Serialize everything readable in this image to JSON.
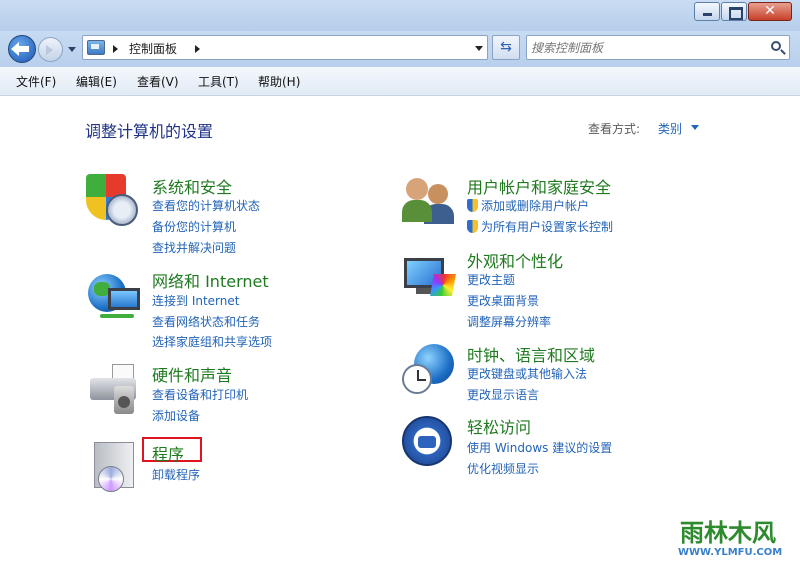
{
  "navbar": {
    "address_path": "控制面板",
    "search_placeholder": "搜索控制面板"
  },
  "menu": [
    "文件(F)",
    "编辑(E)",
    "查看(V)",
    "工具(T)",
    "帮助(H)"
  ],
  "content": {
    "title": "调整计算机的设置",
    "view_label": "查看方式:",
    "view_value": "类别"
  },
  "categories": [
    {
      "title": "系统和安全",
      "links": [
        "查看您的计算机状态",
        "备份您的计算机",
        "查找并解决问题"
      ],
      "icon": "shield-icon"
    },
    {
      "title": "网络和 Internet",
      "links": [
        "连接到 Internet",
        "查看网络状态和任务",
        "选择家庭组和共享选项"
      ],
      "icon": "network-globe-icon"
    },
    {
      "title": "硬件和声音",
      "links": [
        "查看设备和打印机",
        "添加设备"
      ],
      "icon": "printer-speaker-icon"
    },
    {
      "title": "程序",
      "links": [
        "卸载程序"
      ],
      "icon": "programs-disc-icon"
    },
    {
      "title": "用户帐户和家庭安全",
      "links": [
        "添加或删除用户帐户",
        "为所有用户设置家长控制"
      ],
      "icon": "users-icon"
    },
    {
      "title": "外观和个性化",
      "links": [
        "更改主题",
        "更改桌面背景",
        "调整屏幕分辨率"
      ],
      "icon": "monitor-palette-icon"
    },
    {
      "title": "时钟、语言和区域",
      "links": [
        "更改键盘或其他输入法",
        "更改显示语言"
      ],
      "icon": "clock-globe-icon"
    },
    {
      "title": "轻松访问",
      "links": [
        "使用 Windows 建议的设置",
        "优化视频显示"
      ],
      "icon": "ease-of-access-icon"
    }
  ],
  "watermark": {
    "text": "雨林木风",
    "url": "WWW.YLMFU.COM"
  },
  "colors": {
    "link": "#2364b8",
    "category_title": "#1f7a1f",
    "highlight": "#e0141e"
  }
}
